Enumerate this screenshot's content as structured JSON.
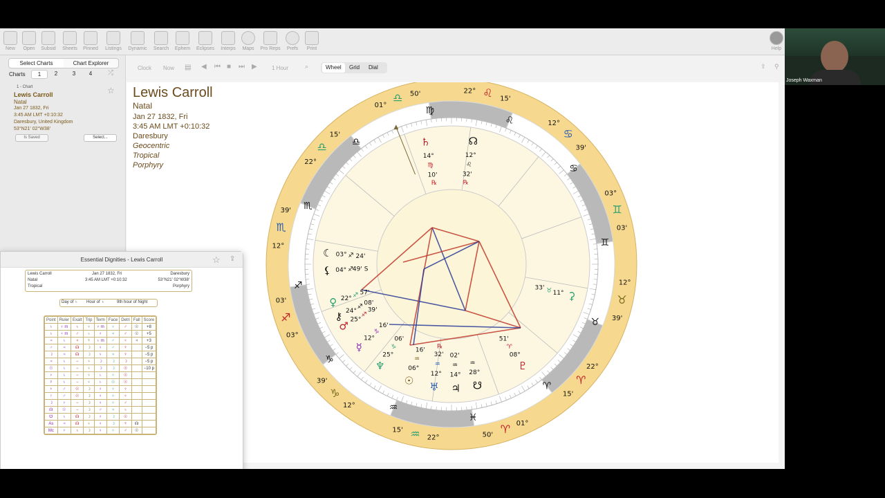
{
  "toolbar": {
    "items": [
      "New",
      "Open",
      "Subsid",
      "Sheets",
      "Pinned",
      "Listings",
      "Dynamic",
      "Search",
      "Ephem",
      "Eclipses",
      "Interps",
      "Maps",
      "Pro Reps",
      "Prefs",
      "Print"
    ],
    "help": "Help"
  },
  "sidebar": {
    "tab_select": "Select Charts",
    "tab_explorer": "Chart Explorer",
    "charts_label": "Charts",
    "chart_tabs": [
      "1",
      "2",
      "3",
      "4"
    ],
    "chart_index": "1 - Chart",
    "name": "Lewis Carroll",
    "type": "Natal",
    "date": "Jan 27 1832, Fri",
    "time": "3:45 AM LMT +0:10:32",
    "place": "Daresbury, United Kingdom",
    "coords": "53°N21' 02°W38'",
    "saved_btn": "Is Saved",
    "select_btn": "Select..."
  },
  "nav": {
    "clock": "Clock",
    "now": "Now",
    "step": "1 Hour",
    "views": [
      "Wheel",
      "Grid",
      "Dial"
    ]
  },
  "chart_info": {
    "name": "Lewis Carroll",
    "type": "Natal",
    "date": "Jan 27 1832, Fri",
    "time": "3:45 AM LMT +0:10:32",
    "place": "Daresbury",
    "system1": "Geocentric",
    "system2": "Tropical",
    "system3": "Porphyry"
  },
  "wheel": {
    "signs": [
      {
        "glyph": "♍",
        "color": "#7a6a1a"
      },
      {
        "glyph": "♌",
        "color": "#c0202a"
      },
      {
        "glyph": "♋",
        "color": "#2a5ab0"
      },
      {
        "glyph": "♊",
        "color": "#2aa070"
      },
      {
        "glyph": "♉",
        "color": "#7a6a1a"
      },
      {
        "glyph": "♈",
        "color": "#c0202a"
      },
      {
        "glyph": "♓",
        "color": "#2a5ab0"
      },
      {
        "glyph": "♒",
        "color": "#2aa070"
      },
      {
        "glyph": "♑",
        "color": "#7a6a1a"
      },
      {
        "glyph": "♐",
        "color": "#c0202a"
      },
      {
        "glyph": "♏",
        "color": "#2a5ab0"
      },
      {
        "glyph": "♎",
        "color": "#2aa070"
      }
    ],
    "cusp_labels": [
      {
        "deg": "22°",
        "min": "15'",
        "sign": "♌",
        "color": "#c0202a"
      },
      {
        "deg": "12°",
        "min": "39'",
        "sign": "♋",
        "color": "#2a5ab0"
      },
      {
        "deg": "03°",
        "min": "03'",
        "sign": "♊",
        "color": "#2aa070"
      },
      {
        "deg": "12°",
        "min": "39'",
        "sign": "♉",
        "color": "#7a6a1a"
      },
      {
        "deg": "22°",
        "min": "15'",
        "sign": "♈",
        "color": "#c0202a"
      },
      {
        "deg": "01°",
        "min": "50'",
        "sign": "♈",
        "color": "#c0202a"
      },
      {
        "deg": "22°",
        "min": "15'",
        "sign": "♒",
        "color": "#2aa070"
      },
      {
        "deg": "12°",
        "min": "39'",
        "sign": "♑",
        "color": "#7a6a1a"
      },
      {
        "deg": "03°",
        "min": "03'",
        "sign": "♐",
        "color": "#c0202a"
      },
      {
        "deg": "12°",
        "min": "39'",
        "sign": "♏",
        "color": "#2a5ab0"
      },
      {
        "deg": "22°",
        "min": "15'",
        "sign": "♎",
        "color": "#2aa070"
      },
      {
        "deg": "01°",
        "min": "50'",
        "sign": "♎",
        "color": "#2aa070"
      }
    ],
    "planets": [
      {
        "glyph": "♄",
        "deg": "14°",
        "sign": "♍",
        "min": "10'",
        "rx": "℞",
        "color": "#c0202a"
      },
      {
        "glyph": "☊",
        "deg": "12°",
        "sign": "♌",
        "min": "32'",
        "rx": "℞",
        "color": "#111"
      },
      {
        "glyph": "☾",
        "deg": "03°",
        "sign": "♐",
        "min": "24'",
        "rx": "",
        "color": "#111"
      },
      {
        "glyph": "⚸",
        "deg": "04°",
        "sign": "♐",
        "min": "49' S",
        "rx": "",
        "color": "#111"
      },
      {
        "glyph": "♀",
        "deg": "22°",
        "sign": "♐",
        "min": "57'",
        "rx": "",
        "color": "#2aa070"
      },
      {
        "glyph": "⚷",
        "deg": "24°",
        "sign": "♐",
        "min": "08'",
        "rx": "",
        "color": "#111"
      },
      {
        "glyph": "♂",
        "deg": "25°",
        "sign": "♐",
        "min": "39'",
        "rx": "",
        "color": "#c0202a"
      },
      {
        "glyph": "☿",
        "deg": "12°",
        "sign": "♑",
        "min": "16'",
        "rx": "",
        "color": "#8a2ab0"
      },
      {
        "glyph": "♆",
        "deg": "25°",
        "sign": "♑",
        "min": "06'",
        "rx": "",
        "color": "#2aa070"
      },
      {
        "glyph": "☉",
        "deg": "06°",
        "sign": "♒",
        "min": "16'",
        "rx": "",
        "color": "#7a5a1a"
      },
      {
        "glyph": "♅",
        "deg": "12°",
        "sign": "♒",
        "min": "32'",
        "rx": "℞",
        "color": "#2a5ab0"
      },
      {
        "glyph": "♃",
        "deg": "14°",
        "sign": "♒",
        "min": "02'",
        "rx": "",
        "color": "#111"
      },
      {
        "glyph": "♇",
        "deg": "08°",
        "sign": "♈",
        "min": "51'",
        "rx": "",
        "color": "#c0202a"
      },
      {
        "glyph": "⚳",
        "deg": "11°",
        "sign": "♉",
        "min": "33'",
        "rx": "",
        "color": "#2aa070"
      },
      {
        "glyph": "☋",
        "deg": "28°",
        "sign": "♒",
        "min": "",
        "rx": "",
        "color": "#111"
      }
    ]
  },
  "dignities": {
    "title": "Essential Dignities - Lewis Carroll",
    "header": {
      "name": "Lewis Carroll",
      "date": "Jan 27 1832, Fri",
      "place": "Daresbury",
      "type": "Natal",
      "time": "3:45 AM LMT +0:10:32",
      "coords": "53°N21' 02°W38'",
      "zodiac": "Tropical",
      "houses": "Porphyry"
    },
    "day": "Day of ♄",
    "hour": "Hour of ♄",
    "night": "9th hour of Night",
    "columns": [
      "Point",
      "Ruler",
      "Exalt",
      "Trip",
      "Term",
      "Face",
      "Detri",
      "Fall",
      "Score"
    ],
    "rows": [
      [
        "♄",
        "♀ m",
        "♄",
        "♀",
        "♀ m",
        "♀",
        "♂",
        "☉",
        "+8"
      ],
      [
        "♄",
        "♀ m",
        "♂",
        "♄",
        "♀",
        "♃",
        "♂",
        "☉",
        "+5"
      ],
      [
        "♃",
        "♄",
        "♃",
        "☿",
        "♄ m",
        "♂",
        "♀",
        "♃",
        "+3"
      ],
      [
        "♂",
        "♃",
        "☊",
        "☽",
        "♀",
        "♂",
        "☿",
        "",
        "−5 p"
      ],
      [
        "☽",
        "♃",
        "☊",
        "☽",
        "♀",
        "♃",
        "☿",
        "",
        "−5 p"
      ],
      [
        "♃",
        "♄",
        "−",
        "♀",
        "☽",
        "☽",
        "☽",
        "",
        "−5 p"
      ],
      [
        "☉",
        "♄",
        "−",
        "♀",
        "☽",
        "☽",
        "☉",
        "",
        "−10 p"
      ],
      [
        "♀",
        "♄",
        "−",
        "♀",
        "♄",
        "♀",
        "☉",
        "",
        ""
      ],
      [
        "☿",
        "♄",
        "−",
        "♀",
        "♄",
        "☉",
        "☉",
        "",
        ""
      ],
      [
        "♆",
        "♂",
        "☉",
        "☽",
        "♀",
        "♀",
        "♀",
        "",
        ""
      ],
      [
        "♇",
        "♂",
        "☉",
        "☽",
        "♀",
        "♀",
        "♀",
        "",
        ""
      ],
      [
        "☽",
        "♀",
        "−",
        "☽",
        "♀",
        "♀",
        "♂",
        "",
        ""
      ],
      [
        "☊",
        "☉",
        "−",
        "☽",
        "♂",
        "♃",
        "♄",
        "",
        ""
      ],
      [
        "☋",
        "♄",
        "☊",
        "☽",
        "♀",
        "☽",
        "☉",
        "",
        ""
      ],
      [
        "As",
        "♃",
        "☊",
        "♀",
        "♀",
        "☽",
        "☿",
        "☊",
        ""
      ],
      [
        "Mc",
        "♀",
        "♄",
        "☽",
        "♀",
        "♀",
        "♂",
        "☉",
        ""
      ]
    ]
  },
  "video": {
    "name": "Joseph Waxman"
  }
}
